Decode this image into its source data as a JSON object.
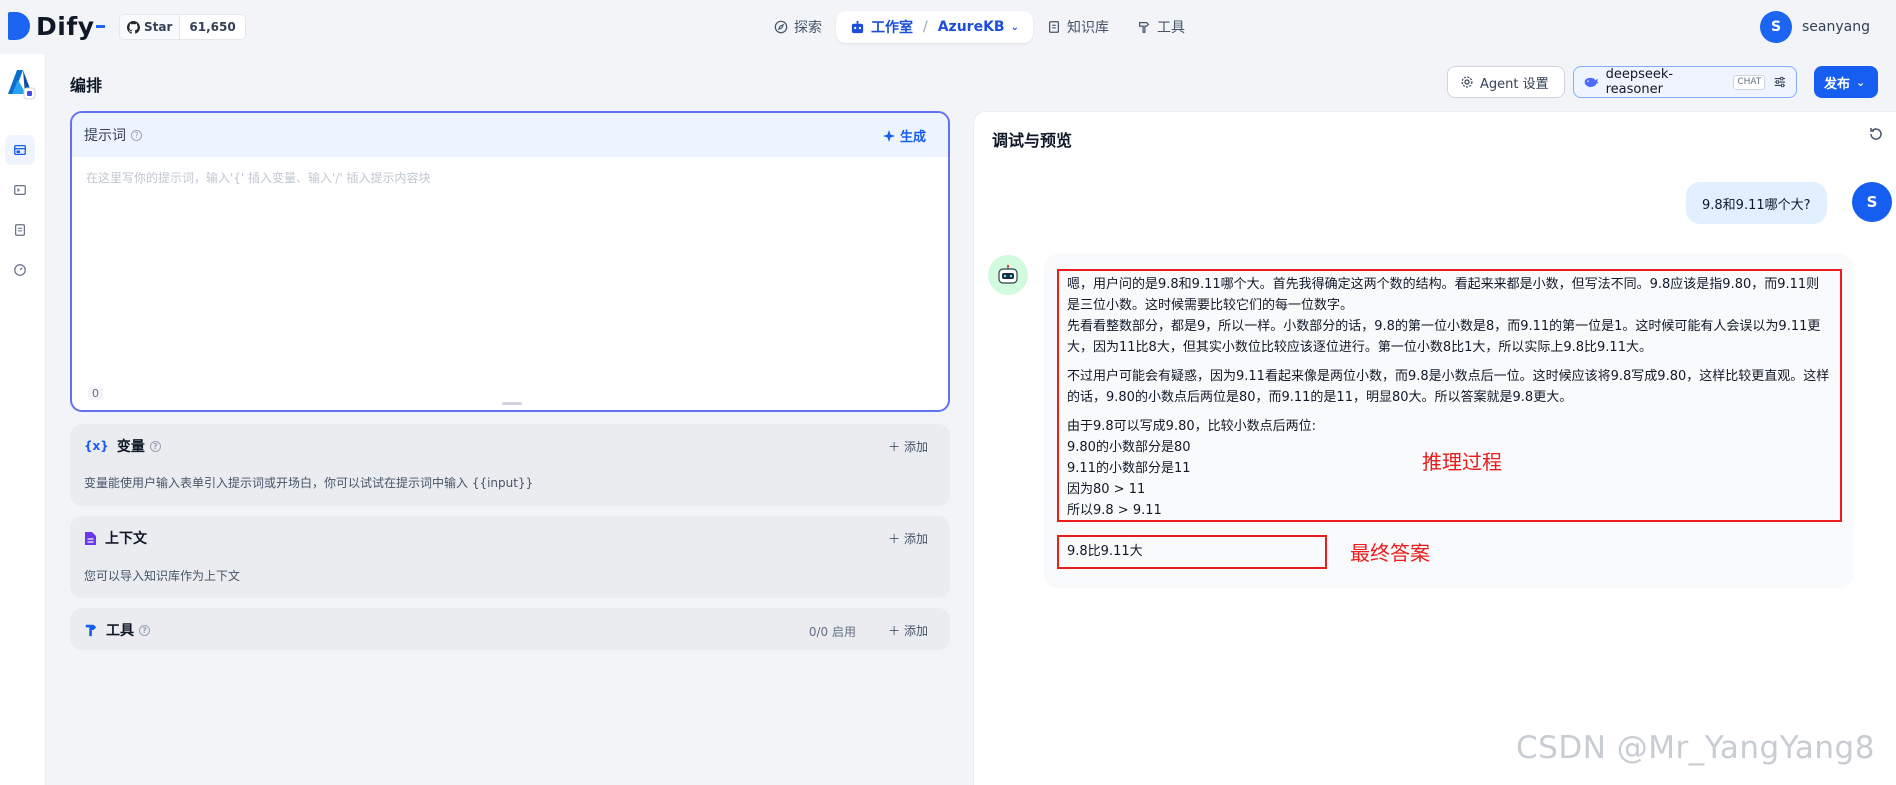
{
  "app": {
    "name": "Dify",
    "github": {
      "label": "Star",
      "count": "61,650"
    }
  },
  "nav": {
    "explore": "探索",
    "studio": "工作室",
    "current_app": "AzureKB",
    "knowledge": "知识库",
    "tools": "工具"
  },
  "user": {
    "initial": "S",
    "name": "seanyang"
  },
  "header": {
    "title": "编排",
    "agent_settings": "Agent 设置",
    "model": "deepseek-reasoner",
    "model_badge": "CHAT",
    "publish": "发布"
  },
  "prompt": {
    "label": "提示词",
    "generate": "生成",
    "placeholder": "在这里写你的提示词，输入'{' 插入变量、输入'/' 插入提示内容块",
    "count": "0"
  },
  "variables": {
    "title": "变量",
    "add": "添加",
    "description": "变量能使用户输入表单引入提示词或开场白，你可以试试在提示词中输入 {{input}}"
  },
  "context": {
    "title": "上下文",
    "add": "添加",
    "description": "您可以导入知识库作为上下文"
  },
  "tools": {
    "title": "工具",
    "enabled": "0/0 启用",
    "add": "添加"
  },
  "preview": {
    "title": "调试与预览",
    "user_initial": "S",
    "user_message": "9.8和9.11哪个大?",
    "reasoning": [
      "嗯，用户问的是9.8和9.11哪个大。首先我得确定这两个数的结构。看起来来都是小数，但写法不同。9.8应该是指9.80，而9.11则是三位小数。这时候需要比较它们的每一位数字。",
      "先看看整数部分，都是9，所以一样。小数部分的话，9.8的第一位小数是8，而9.11的第一位是1。这时候可能有人会误以为9.11更大，因为11比8大，但其实小数位比较应该逐位进行。第一位小数8比1大，所以实际上9.8比9.11大。",
      "不过用户可能会有疑惑，因为9.11看起来像是两位小数，而9.8是小数点后一位。这时候应该将9.8写成9.80，这样比较更直观。这样的话，9.80的小数点后两位是80，而9.11的是11，明显80大。所以答案就是9.8更大。",
      "由于9.8可以写成9.80，比较小数点后两位:"
    ],
    "reasoning_lines": [
      "9.80的小数部分是80",
      "9.11的小数部分是11",
      "因为80 > 11",
      "所以9.8 > 9.11"
    ],
    "final_answer": "9.8比9.11大",
    "annotation_reasoning": "推理过程",
    "annotation_final": "最终答案"
  },
  "watermark": "CSDN @Mr_YangYang8",
  "colors": {
    "accent": "#155eef",
    "highlight_red": "#ea1c1c",
    "user_bubble": "#e1effe"
  }
}
